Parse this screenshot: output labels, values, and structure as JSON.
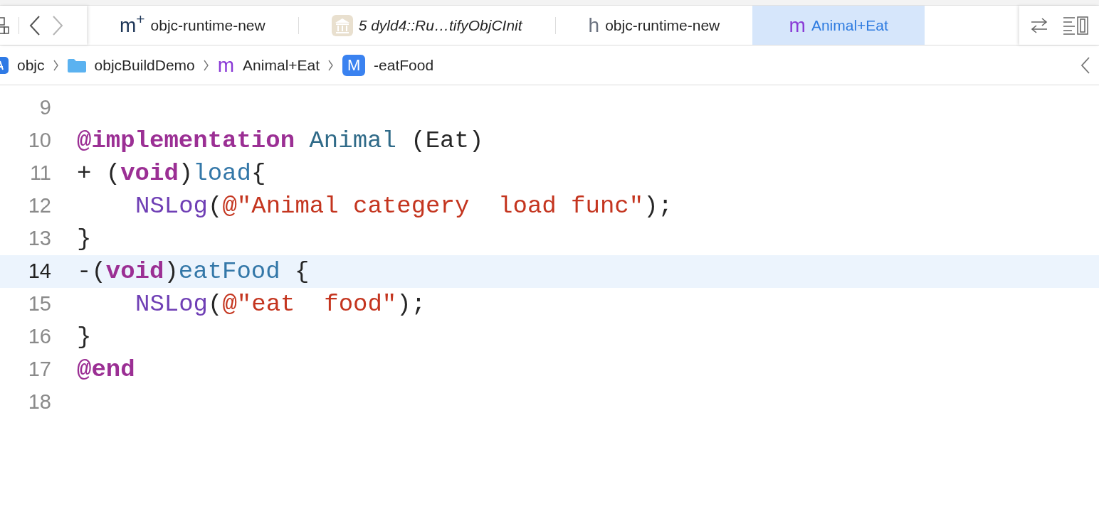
{
  "nav": {
    "back_enabled": true,
    "forward_enabled": false
  },
  "tabs": [
    {
      "kind": "implementation-plus",
      "icon": "m$^{+}$",
      "label": "objc-runtime-new",
      "preview": false,
      "selected": false
    },
    {
      "kind": "library",
      "label": "5 dyld4::Ru…tifyObjCInit",
      "preview": true,
      "selected": false
    },
    {
      "kind": "header",
      "icon": "h",
      "label": "objc-runtime-new",
      "preview": false,
      "selected": false
    },
    {
      "kind": "implementation",
      "icon": "m",
      "label": "Animal+Eat",
      "preview": false,
      "selected": true
    }
  ],
  "breadcrumb": [
    {
      "kind": "project",
      "label": "objc"
    },
    {
      "kind": "folder",
      "label": "objcBuildDemo"
    },
    {
      "kind": "implementation",
      "icon": "m",
      "label": "Animal+Eat"
    },
    {
      "kind": "method",
      "icon": "M",
      "label": "-eatFood"
    }
  ],
  "editor": {
    "lines": [
      {
        "number": "9",
        "current": false
      },
      {
        "number": "10",
        "current": false,
        "indented": false,
        "tokens": [
          {
            "kind": "keyword",
            "text": "@implementation"
          },
          {
            "kind": "class",
            "text": " Animal"
          },
          {
            "kind": "plain",
            "text": " (Eat)"
          }
        ]
      },
      {
        "number": "11",
        "current": false,
        "indented": false,
        "tokens": [
          {
            "kind": "plain",
            "text": "+ ("
          },
          {
            "kind": "keyword",
            "text": "void"
          },
          {
            "kind": "plain",
            "text": ")"
          },
          {
            "kind": "method",
            "text": "load"
          },
          {
            "kind": "plain",
            "text": "{"
          }
        ]
      },
      {
        "number": "12",
        "current": false,
        "indented": true,
        "tokens": [
          {
            "kind": "function",
            "text": "NSLog"
          },
          {
            "kind": "plain",
            "text": "("
          },
          {
            "kind": "string",
            "text": "@\"Animal categery  load func\""
          },
          {
            "kind": "plain",
            "text": ");"
          }
        ]
      },
      {
        "number": "13",
        "current": false,
        "indented": false,
        "tokens": [
          {
            "kind": "plain",
            "text": "}"
          }
        ]
      },
      {
        "number": "14",
        "current": true,
        "indented": false,
        "tokens": [
          {
            "kind": "plain",
            "text": "-("
          },
          {
            "kind": "keyword",
            "text": "void"
          },
          {
            "kind": "plain",
            "text": ")"
          },
          {
            "kind": "method",
            "text": "eatFood"
          },
          {
            "kind": "plain",
            "text": " {"
          }
        ]
      },
      {
        "number": "15",
        "current": false,
        "indented": true,
        "tokens": [
          {
            "kind": "function",
            "text": "NSLog"
          },
          {
            "kind": "plain",
            "text": "("
          },
          {
            "kind": "string",
            "text": "@\"eat  food\""
          },
          {
            "kind": "plain",
            "text": ");"
          }
        ]
      },
      {
        "number": "16",
        "current": false,
        "indented": false,
        "tokens": [
          {
            "kind": "plain",
            "text": "}"
          }
        ]
      },
      {
        "number": "17",
        "current": false,
        "indented": false,
        "tokens": [
          {
            "kind": "keyword",
            "text": "@end"
          }
        ]
      },
      {
        "number": "18",
        "current": false
      }
    ]
  }
}
